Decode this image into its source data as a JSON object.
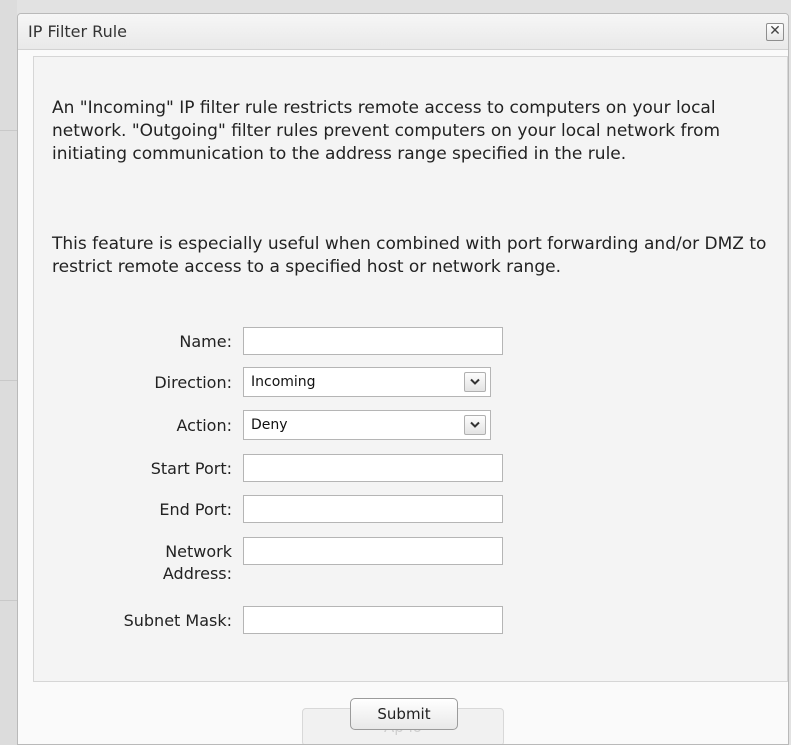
{
  "dialog": {
    "title": "IP Filter Rule",
    "close_icon": "close-icon",
    "close_glyph": "✕"
  },
  "description": {
    "paragraph1": "An \"Incoming\" IP filter rule restricts remote access to computers on your local network. \"Outgoing\" filter rules prevent computers on your local network from initiating communication to the address range specified in the rule.",
    "paragraph2": "This feature is especially useful when combined with port forwarding and/or DMZ to restrict remote access to a specified host or network range."
  },
  "form": {
    "name": {
      "label": "Name:",
      "value": ""
    },
    "direction": {
      "label": "Direction:",
      "value": "Incoming",
      "icon": "chevron-down-icon"
    },
    "action": {
      "label": "Action:",
      "value": "Deny",
      "icon": "chevron-down-icon"
    },
    "start_port": {
      "label": "Start Port:",
      "value": ""
    },
    "end_port": {
      "label": "End Port:",
      "value": ""
    },
    "network_address": {
      "label_line1": "Network",
      "label_line2": "Address:",
      "value": ""
    },
    "subnet_mask": {
      "label": "Subnet Mask:",
      "value": ""
    }
  },
  "footer": {
    "submit_label": "Submit",
    "background_button_label": "Ap        lo"
  }
}
